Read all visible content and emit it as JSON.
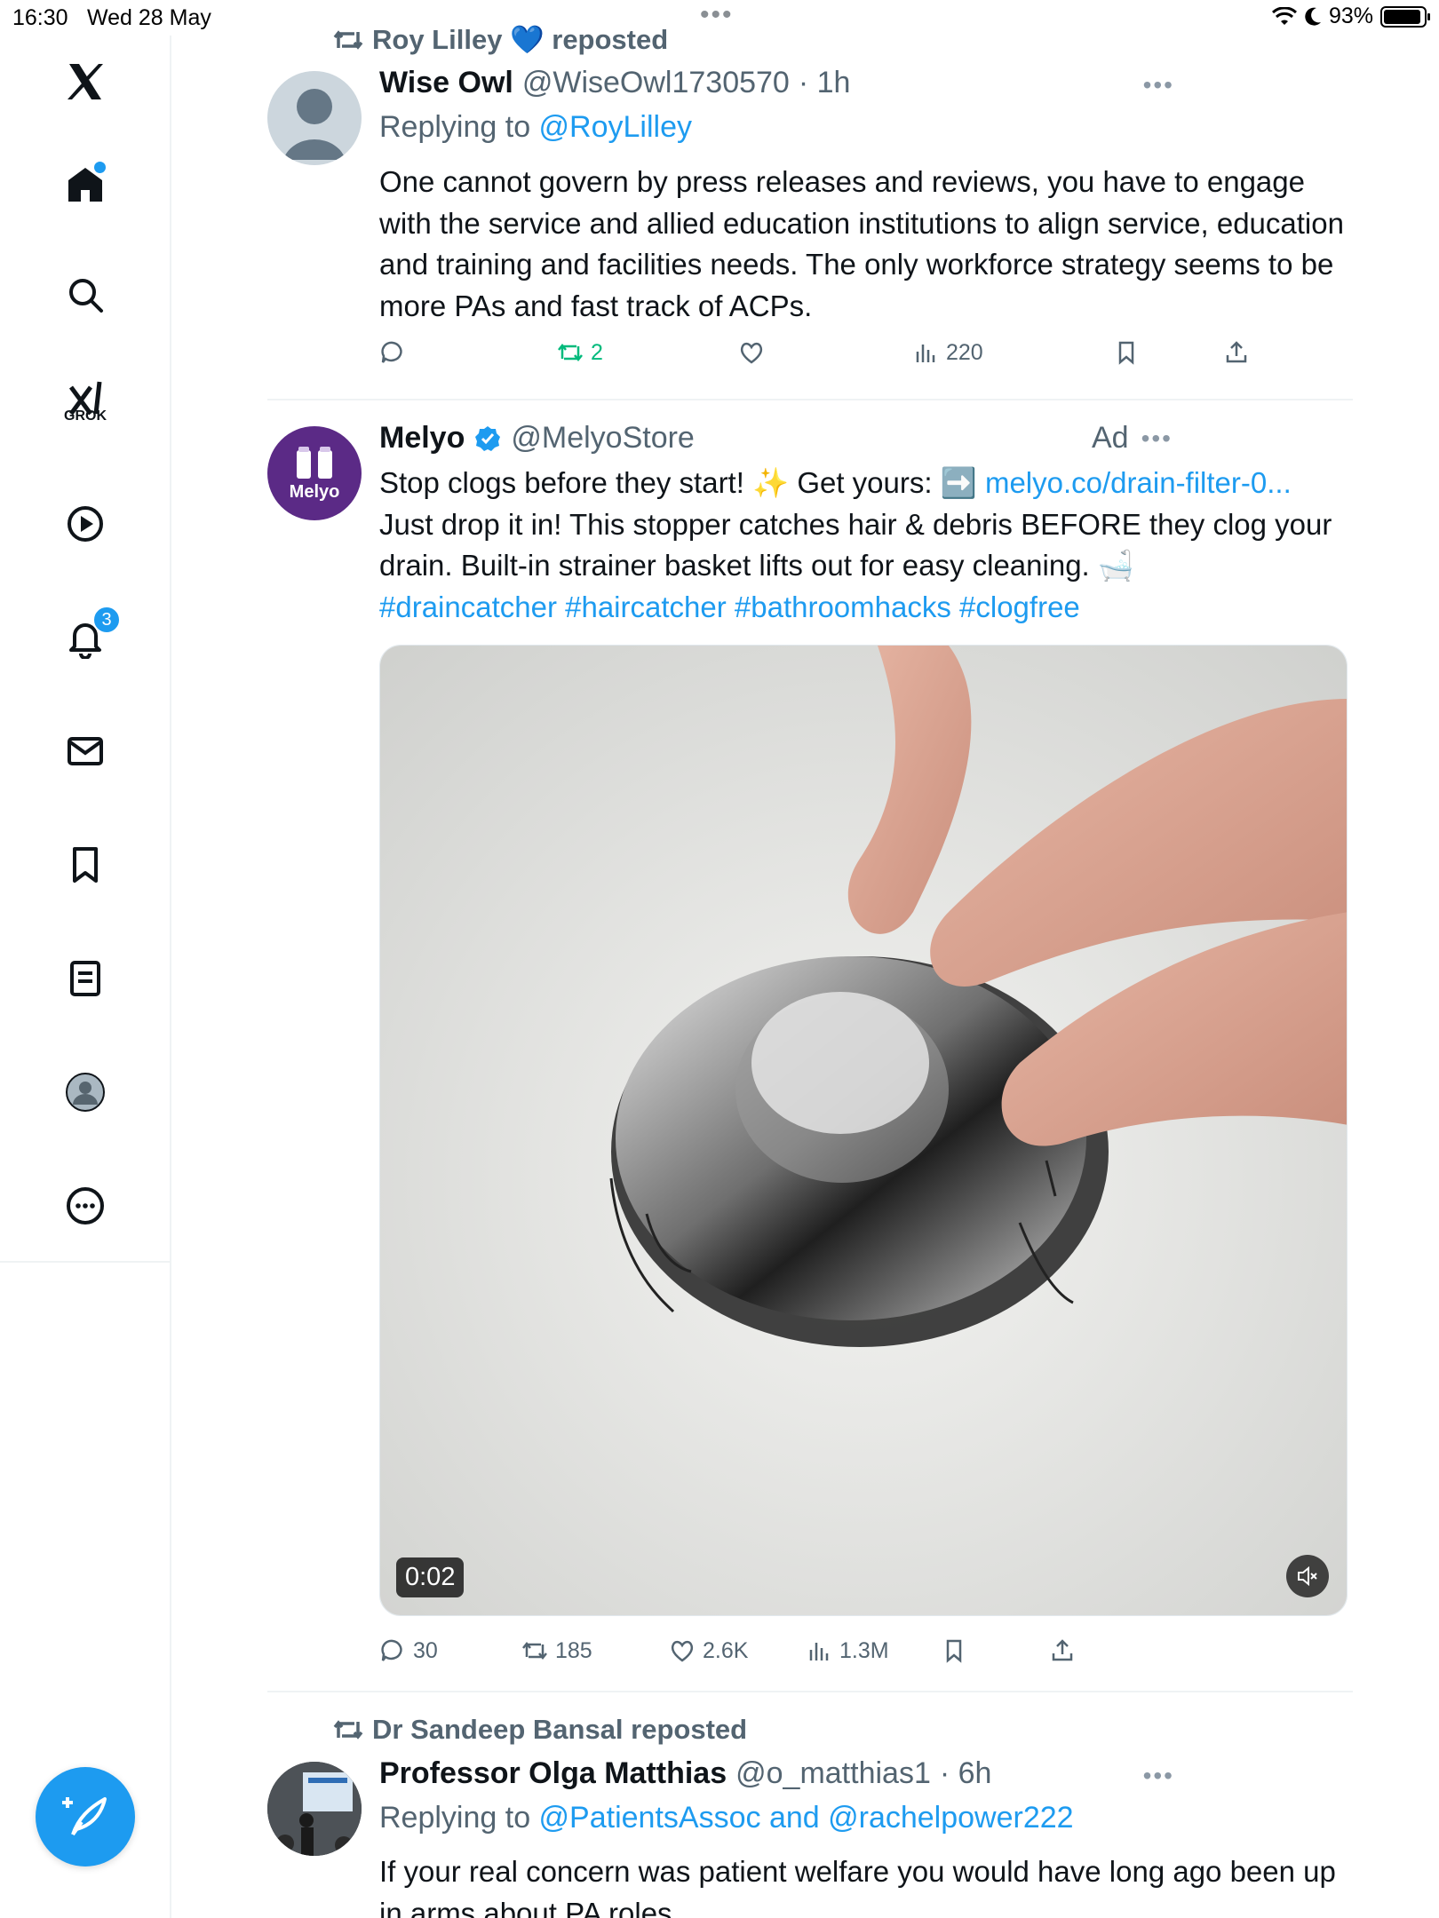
{
  "status_bar": {
    "time": "16:30",
    "date": "Wed 28 May",
    "battery": "93%",
    "battery_level": 0.93
  },
  "sidebar": {
    "items": [
      {
        "icon": "x-logo-icon"
      },
      {
        "icon": "home-icon",
        "active": true
      },
      {
        "icon": "search-icon"
      },
      {
        "icon": "grok-icon",
        "label": "GROK"
      },
      {
        "icon": "video-icon"
      },
      {
        "icon": "notifications-icon",
        "badge": "3"
      },
      {
        "icon": "messages-icon"
      },
      {
        "icon": "bookmarks-icon"
      },
      {
        "icon": "lists-icon"
      },
      {
        "icon": "profile-icon"
      },
      {
        "icon": "more-icon"
      }
    ],
    "compose_icon": "compose-icon"
  },
  "tweets": [
    {
      "social_context": "Roy Lilley 💙 reposted",
      "name": "Wise Owl",
      "handle": "@WiseOwl1730570",
      "time": "· 1h",
      "reply_prefix": "Replying to ",
      "reply_to": "@RoyLilley",
      "text": "One cannot govern by press releases and reviews, you have to engage with the service and allied education institutions to align service, education and training and facilities needs. The only workforce strategy seems to be more PAs and fast track of ACPs.",
      "stats": {
        "replies": "",
        "reposts": "2",
        "likes": "",
        "views": "220"
      }
    },
    {
      "name": "Melyo",
      "verified": true,
      "handle": "@MelyoStore",
      "ad_label": "Ad",
      "avatar_label": "Melyo",
      "text_line1": "Stop clogs before they start! ✨ Get yours: ➡️ ",
      "link": "melyo.co/drain-filter-0...",
      "text_rest": "Just drop it in! This stopper catches hair & debris BEFORE they clog your drain. Built-in strainer basket lifts out for easy cleaning. 🛁",
      "hashtags": "#draincatcher #haircatcher #bathroomhacks #clogfree",
      "video_time": "0:02",
      "stats": {
        "replies": "30",
        "reposts": "185",
        "likes": "2.6K",
        "views": "1.3M"
      }
    },
    {
      "social_context": "Dr Sandeep Bansal reposted",
      "name": "Professor Olga Matthias",
      "handle": "@o_matthias1",
      "time": "· 6h",
      "reply_prefix": "Replying to ",
      "reply_to": "@PatientsAssoc and @rachelpower222",
      "text": "If your real concern was patient welfare you would have long ago been up in arms about PA roles"
    }
  ],
  "colors": {
    "accent": "#1d9bf0",
    "repost_active": "#00ba7c",
    "muted": "#536471",
    "melyo_purple": "#5b2a86"
  }
}
